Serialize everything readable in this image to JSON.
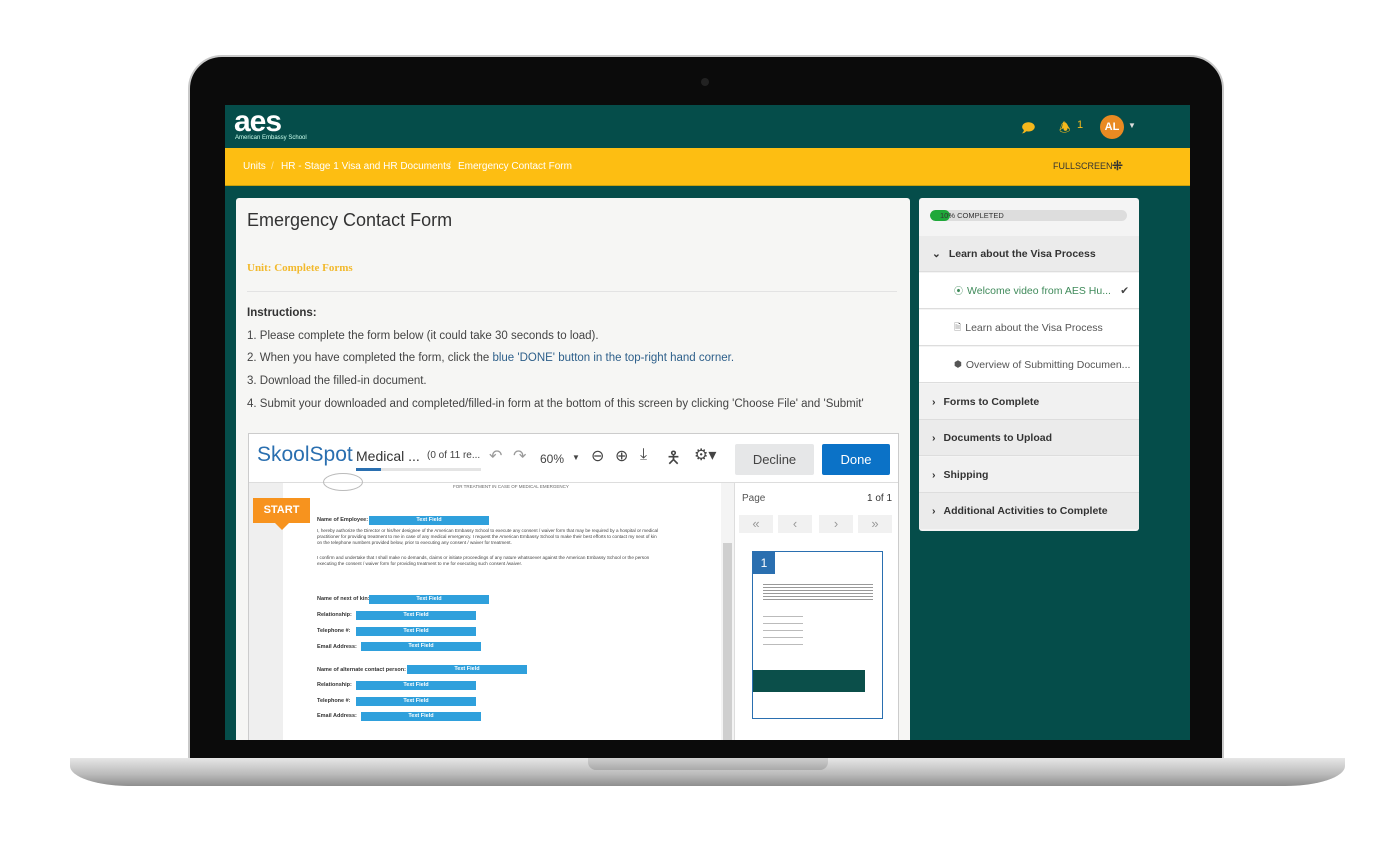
{
  "header": {
    "logo": "aes",
    "logo_sub": "American Embassy School",
    "notifications_count": "1",
    "avatar_initials": "AL"
  },
  "breadcrumb": [
    "Units",
    "HR - Stage 1 Visa and HR Documents",
    "Emergency Contact Form"
  ],
  "breadcrumb_sep": "/",
  "fullscreen_label": "FULLSCREEN",
  "main": {
    "title": "Emergency Contact Form",
    "unit": "Unit: Complete Forms",
    "instructions_heading": "Instructions:",
    "step1": "1. Please complete the form below (it could take 30 seconds to load).",
    "step2_pre": "2. When you have completed the form, click the ",
    "step2_link": "blue 'DONE' button in the top-right hand corner.",
    "step3": "3. Download the filled-in document.",
    "step4": "4. Submit your downloaded and completed/filled-in form at the bottom of this screen by clicking 'Choose File' and 'Submit'"
  },
  "viewer": {
    "brand": "SkoolSpot",
    "doc_title": "Medical ...",
    "progress_text": "(0 of 11 re...",
    "zoom": "60%",
    "decline": "Decline",
    "done": "Done",
    "start": "START",
    "doc_header": "FOR TREATMENT IN CASE OF MEDICAL EMERGENCY",
    "field_placeholder": "Text Field",
    "para1": "I, hereby authorize the Director or his/her designee of the American Embassy School to execute any consent / waiver form that may be required by a hospital or medical practitioner for providing treatment to me in case of any medical emergency. I request the American Embassy School to make their best efforts to contact my next of kin on the telephone numbers provided below, prior to executing any consent / waiver for treatment.",
    "para2": "I confirm and undertake that I shall make no demands, claims or initiate proceedings of any nature whatsoever against the American Embassy School or the person executing the consent / waiver form for providing treatment to me for executing such consent /waiver.",
    "labels": [
      "Name of Employee:",
      "Name of next of kin:",
      "Relationship:",
      "Telephone #:",
      "Email Address:",
      "Name of alternate contact person:",
      "Relationship:",
      "Telephone #:",
      "Email Address:"
    ],
    "page_label": "Page",
    "page_count": "1 of 1",
    "thumb_number": "1"
  },
  "progress": {
    "percent": 10,
    "label": "10% COMPLETED",
    "color": "#1fa83a"
  },
  "sidebar": {
    "sections": [
      {
        "label": "Learn about the Visa Process",
        "expanded": true
      },
      {
        "label": "Forms to Complete"
      },
      {
        "label": "Documents to Upload"
      },
      {
        "label": "Shipping"
      },
      {
        "label": "Additional Activities to Complete"
      }
    ],
    "items": [
      {
        "label": "Welcome video from AES Hu...",
        "icon": "play-circle-icon",
        "completed": true
      },
      {
        "label": "Learn about the Visa Process",
        "icon": "document-icon"
      },
      {
        "label": "Overview of Submitting Documen...",
        "icon": "package-icon"
      }
    ]
  },
  "colors": {
    "brand_teal": "#054d4a",
    "brand_yellow": "#fdbe12",
    "done_blue": "#0b72c7",
    "start_orange": "#f7931e"
  }
}
